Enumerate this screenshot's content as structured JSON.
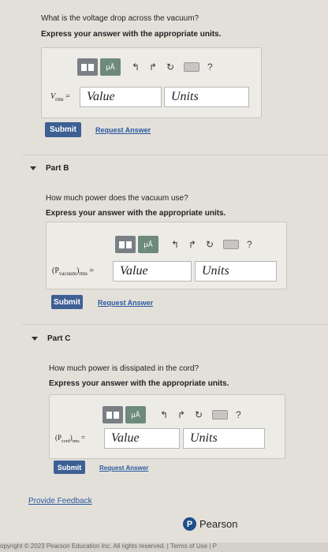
{
  "partA": {
    "question": "What is the voltage drop across the vacuum?",
    "instruction": "Express your answer with the appropriate units.",
    "var_label": "V",
    "var_sub": "rms",
    "value_placeholder": "Value",
    "units_placeholder": "Units",
    "submit": "Submit",
    "request": "Request Answer"
  },
  "partB": {
    "title": "Part B",
    "question": "How much power does the vacuum use?",
    "instruction": "Express your answer with the appropriate units.",
    "var_label": "(P",
    "var_sub": "vacuum",
    "var_rest": ")",
    "var_sub2": "rms",
    "value_placeholder": "Value",
    "units_placeholder": "Units",
    "submit": "Submit",
    "request": "Request Answer"
  },
  "partC": {
    "title": "Part C",
    "question": "How much power is dissipated in the cord?",
    "instruction": "Express your answer with the appropriate units.",
    "var_label": "(P",
    "var_sub": "cord",
    "var_rest": ")",
    "var_sub2": "rms",
    "value_placeholder": "Value",
    "units_placeholder": "Units",
    "submit": "Submit",
    "request": "Request Answer"
  },
  "toolbar": {
    "mu_label": "μÅ",
    "help": "?",
    "icons": [
      "template-icon",
      "mu-angstrom-icon",
      "undo-icon",
      "redo-icon",
      "reset-icon",
      "keyboard-icon",
      "help-icon"
    ]
  },
  "feedback": "Provide Feedback",
  "brand": "Pearson",
  "brand_letter": "P",
  "footer": "opyright © 2023 Pearson Education Inc. All rights reserved. | Terms of Use | P"
}
